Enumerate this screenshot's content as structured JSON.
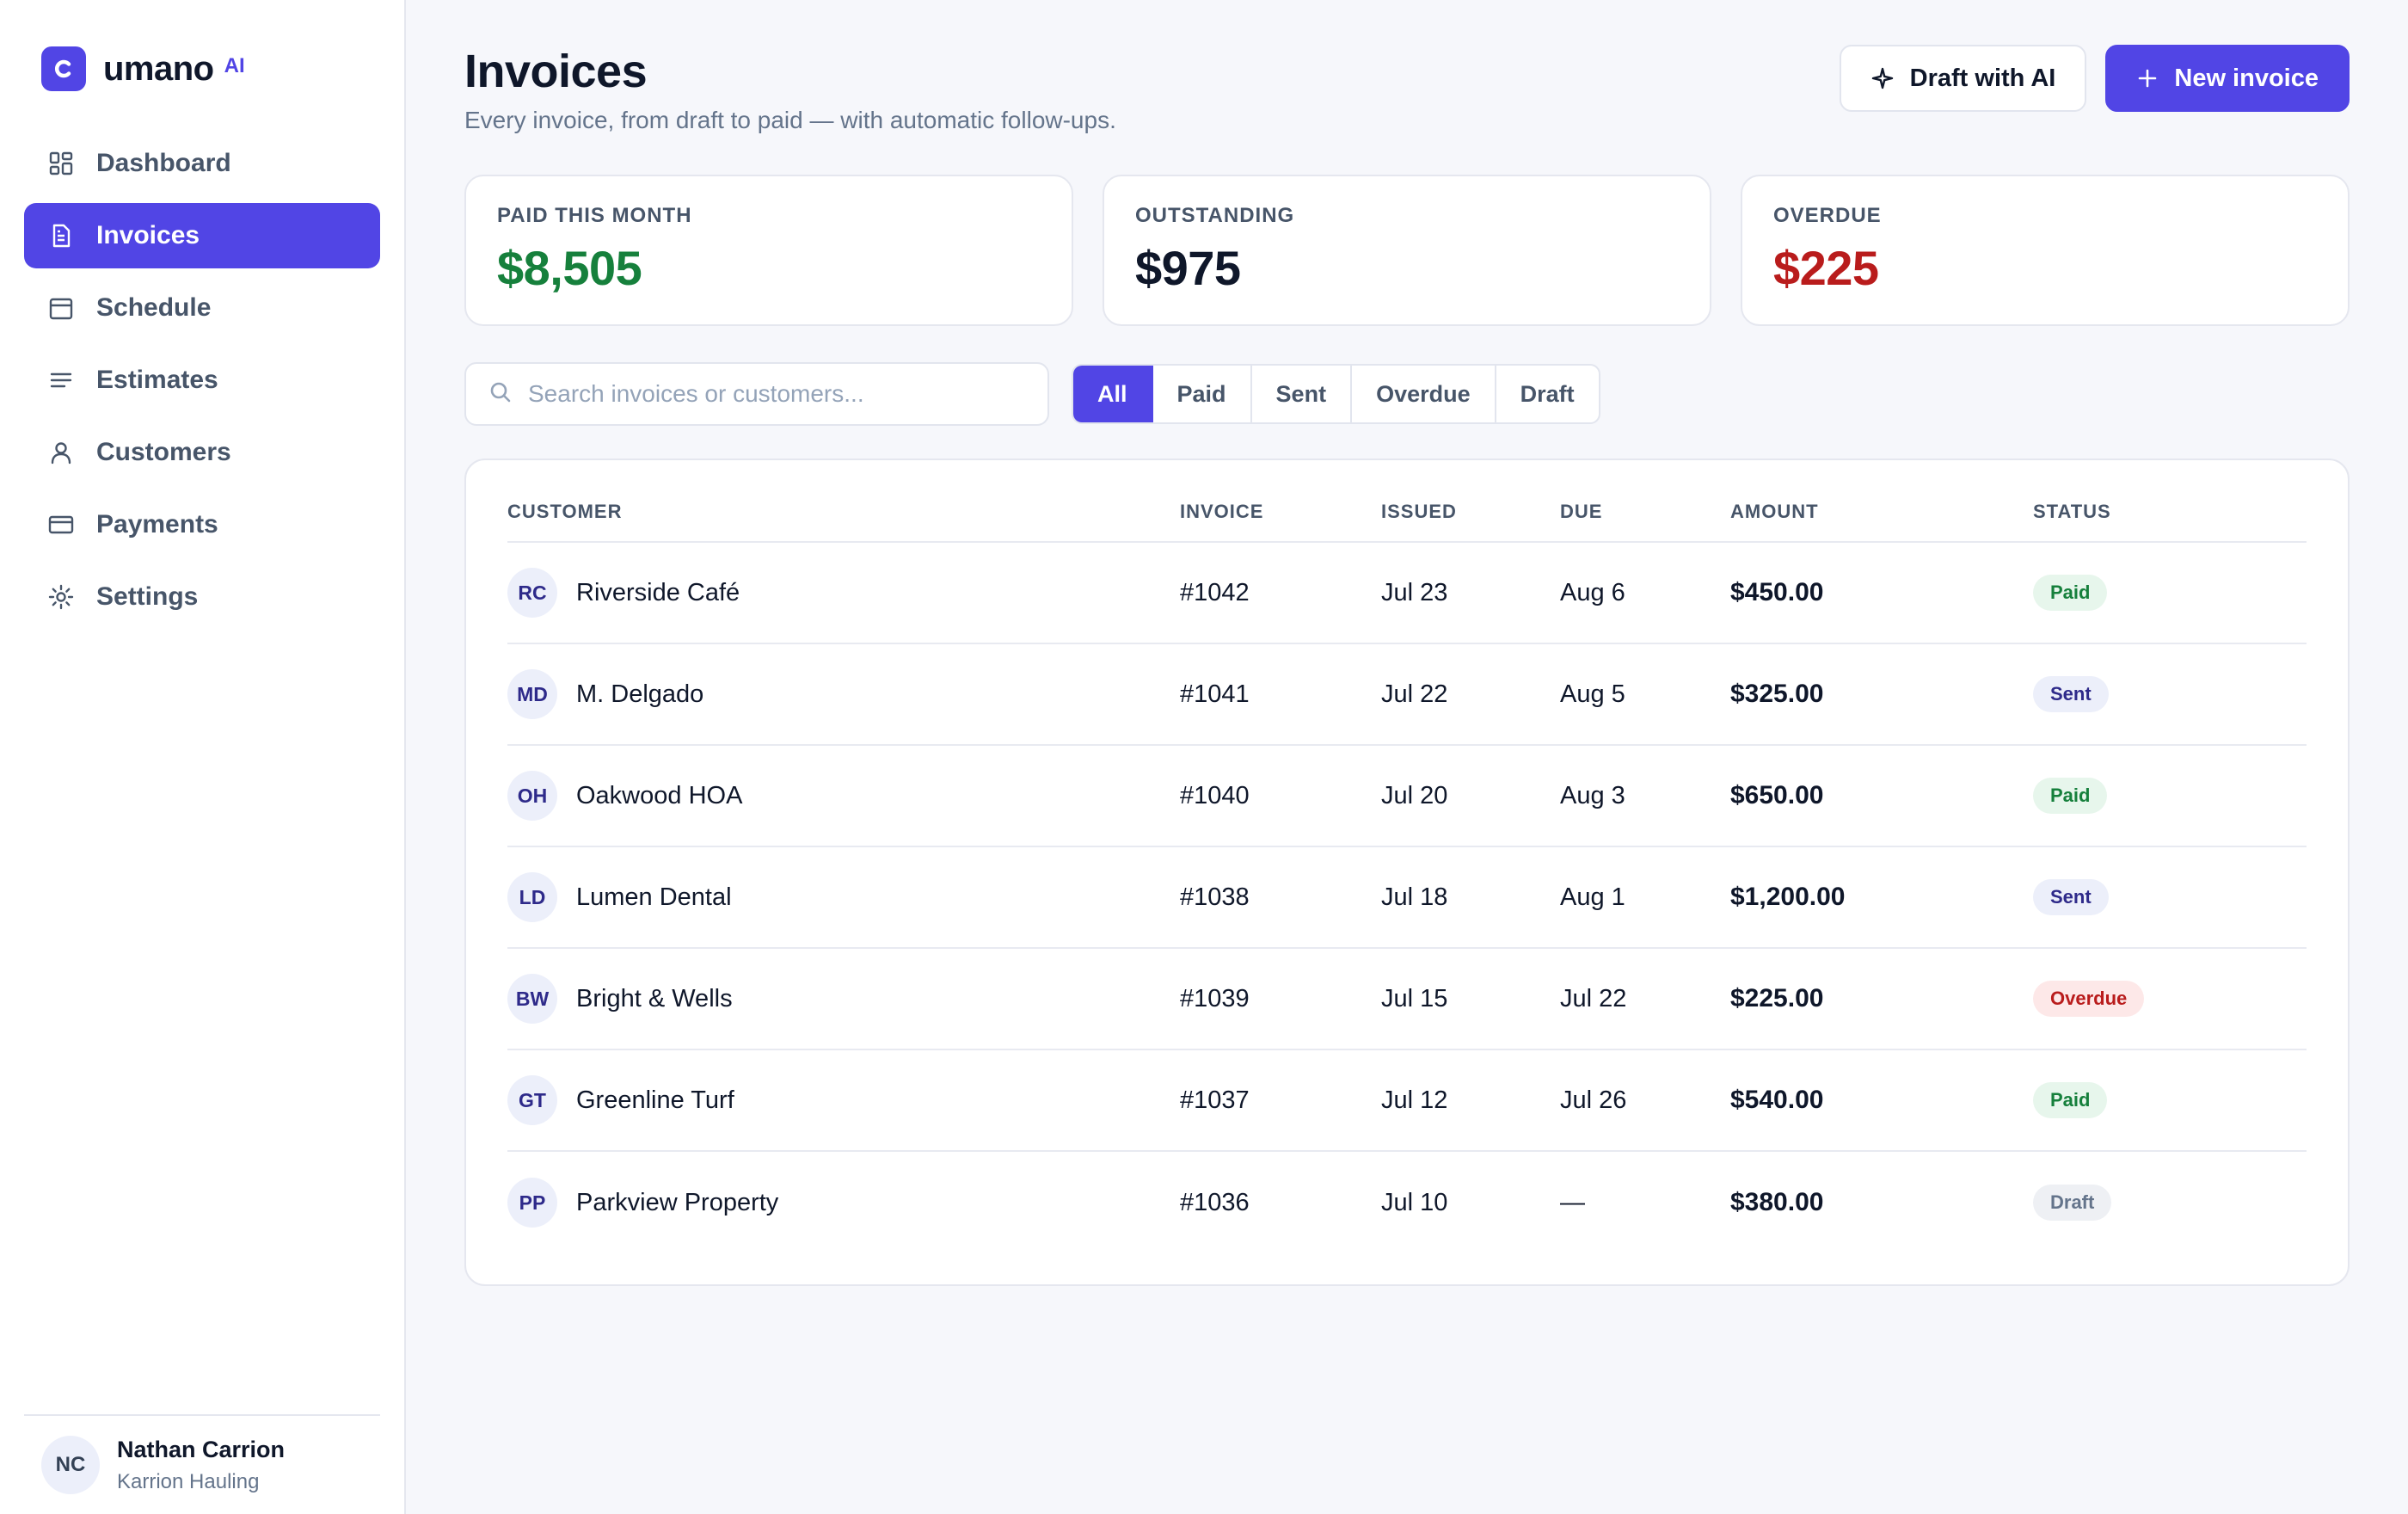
{
  "brand": {
    "name": "umano",
    "badge": "AI",
    "accent": "#5145e5"
  },
  "sidebar": {
    "items": [
      {
        "label": "Dashboard",
        "icon": "grid-icon",
        "active": false
      },
      {
        "label": "Invoices",
        "icon": "document-icon",
        "active": true
      },
      {
        "label": "Schedule",
        "icon": "calendar-icon",
        "active": false
      },
      {
        "label": "Estimates",
        "icon": "list-icon",
        "active": false
      },
      {
        "label": "Customers",
        "icon": "user-icon",
        "active": false
      },
      {
        "label": "Payments",
        "icon": "card-icon",
        "active": false
      },
      {
        "label": "Settings",
        "icon": "gear-icon",
        "active": false
      }
    ]
  },
  "user": {
    "initials": "NC",
    "name": "Nathan Carrion",
    "company": "Karrion Hauling"
  },
  "header": {
    "title": "Invoices",
    "subtitle": "Every invoice, from draft to paid — with automatic follow-ups.",
    "draft_ai_label": "Draft with AI",
    "new_invoice_label": "New invoice"
  },
  "stats": [
    {
      "label": "PAID THIS MONTH",
      "value": "$8,505",
      "color": "#16803c"
    },
    {
      "label": "OUTSTANDING",
      "value": "$975",
      "color": "#0f172a"
    },
    {
      "label": "OVERDUE",
      "value": "$225",
      "color": "#b91c1c"
    }
  ],
  "search": {
    "placeholder": "Search invoices or customers...",
    "value": ""
  },
  "filters": [
    {
      "label": "All",
      "active": true
    },
    {
      "label": "Paid",
      "active": false
    },
    {
      "label": "Sent",
      "active": false
    },
    {
      "label": "Overdue",
      "active": false
    },
    {
      "label": "Draft",
      "active": false
    }
  ],
  "table": {
    "columns": [
      "CUSTOMER",
      "INVOICE",
      "ISSUED",
      "DUE",
      "AMOUNT",
      "STATUS"
    ],
    "rows": [
      {
        "initials": "RC",
        "customer": "Riverside Café",
        "invoice": "#1042",
        "issued": "Jul 23",
        "due": "Aug 6",
        "amount": "$450.00",
        "status": "Paid"
      },
      {
        "initials": "MD",
        "customer": "M. Delgado",
        "invoice": "#1041",
        "issued": "Jul 22",
        "due": "Aug 5",
        "amount": "$325.00",
        "status": "Sent"
      },
      {
        "initials": "OH",
        "customer": "Oakwood HOA",
        "invoice": "#1040",
        "issued": "Jul 20",
        "due": "Aug 3",
        "amount": "$650.00",
        "status": "Paid"
      },
      {
        "initials": "LD",
        "customer": "Lumen Dental",
        "invoice": "#1038",
        "issued": "Jul 18",
        "due": "Aug 1",
        "amount": "$1,200.00",
        "status": "Sent"
      },
      {
        "initials": "BW",
        "customer": "Bright & Wells",
        "invoice": "#1039",
        "issued": "Jul 15",
        "due": "Jul 22",
        "amount": "$225.00",
        "status": "Overdue"
      },
      {
        "initials": "GT",
        "customer": "Greenline Turf",
        "invoice": "#1037",
        "issued": "Jul 12",
        "due": "Jul 26",
        "amount": "$540.00",
        "status": "Paid"
      },
      {
        "initials": "PP",
        "customer": "Parkview Property",
        "invoice": "#1036",
        "issued": "Jul 10",
        "due": "—",
        "amount": "$380.00",
        "status": "Draft"
      }
    ]
  },
  "status_colors": {
    "Paid": {
      "bg": "#e7f6ec",
      "fg": "#16803c"
    },
    "Sent": {
      "bg": "#eceffa",
      "fg": "#2e2a8a"
    },
    "Overdue": {
      "bg": "#fde8e8",
      "fg": "#b91c1c"
    },
    "Draft": {
      "bg": "#eef0f4",
      "fg": "#64748b"
    }
  }
}
